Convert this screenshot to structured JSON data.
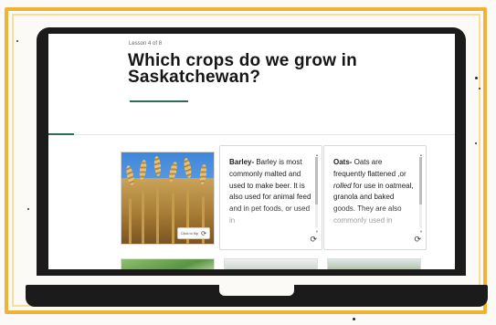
{
  "lesson": {
    "label": "Lesson 4 of 8"
  },
  "page": {
    "title": "Which crops do we grow in Saskatchewan?"
  },
  "cards": {
    "flip_label": "Click to flip",
    "barley": {
      "term": "Barley-",
      "text": " Barley is most commonly malted and used to make beer. It is also used for animal feed and in pet foods, or used in"
    },
    "oats": {
      "term": "Oats-",
      "text_before": " Oats are frequently flattened ,or ",
      "text_italic": "rolled",
      "text_after": " for use in oatmeal, granola and baked goods. They are also commonly used in"
    }
  },
  "icons": {
    "flip": "refresh-icon",
    "scroll_up": "chevron-up-icon",
    "scroll_down": "chevron-down-icon"
  },
  "colors": {
    "frame": "#f2b233",
    "accent": "#2f6b58",
    "laptop": "#1b1b1b"
  }
}
